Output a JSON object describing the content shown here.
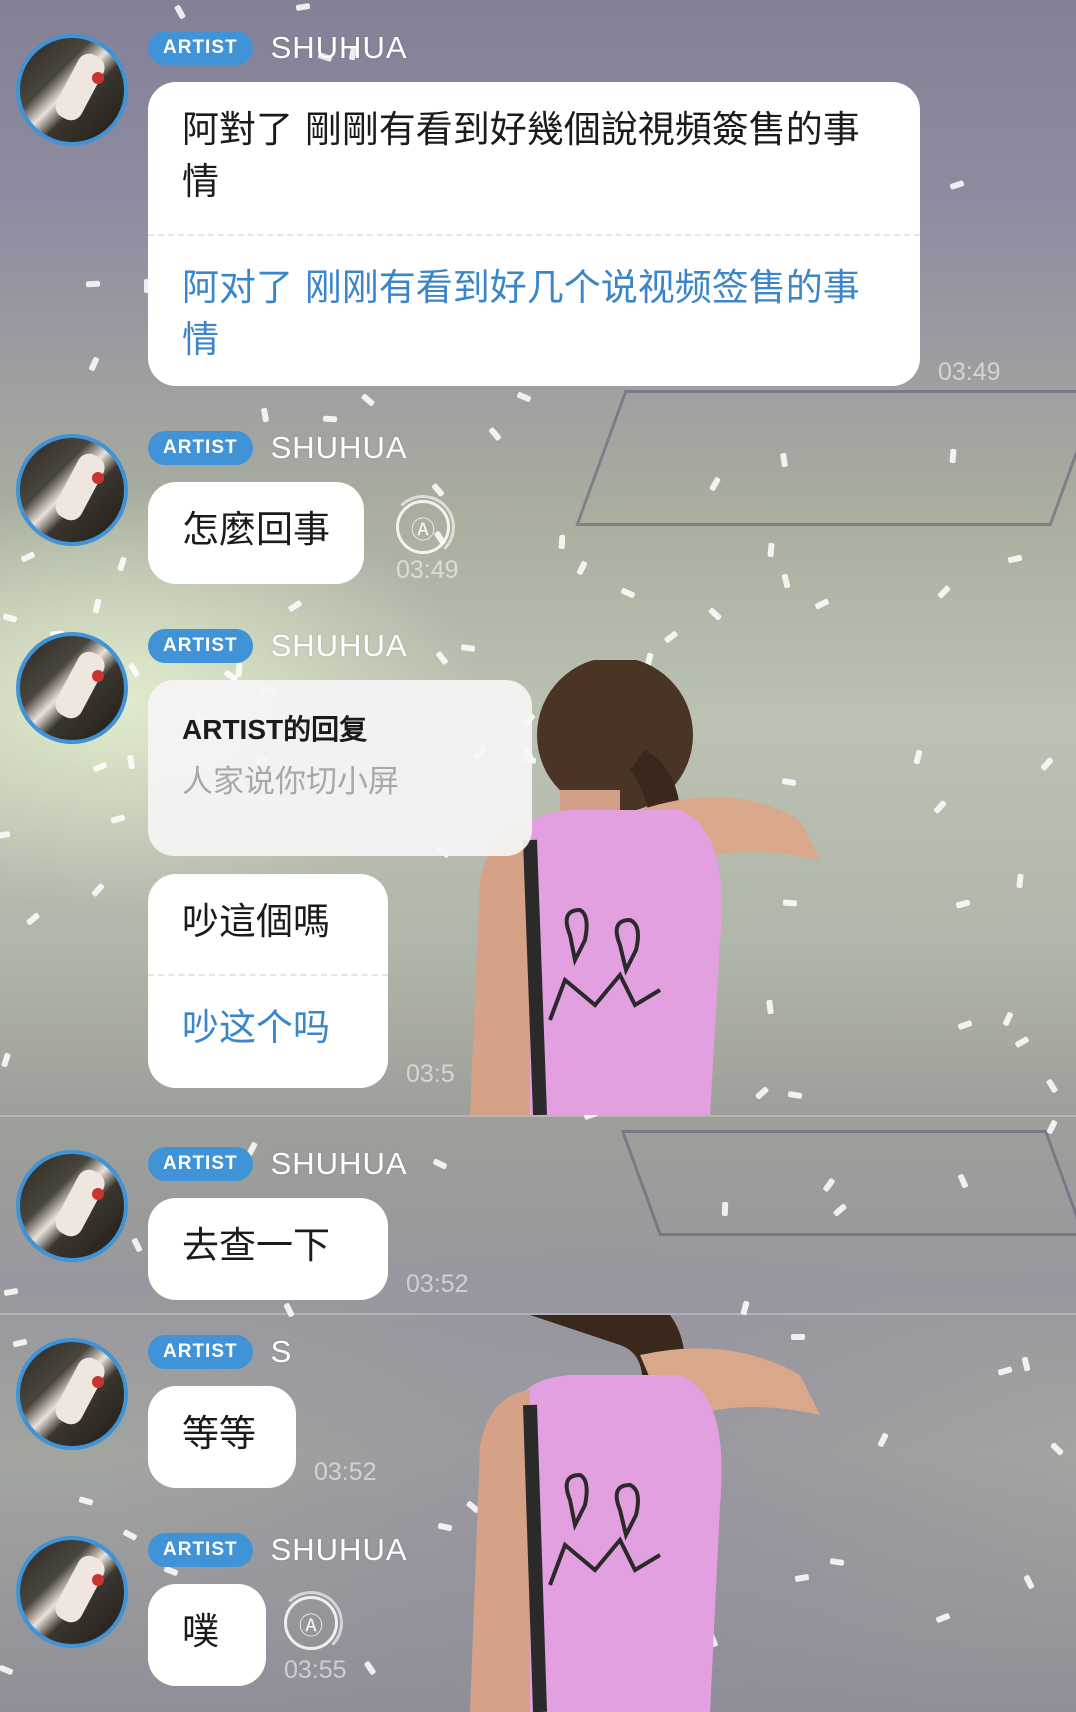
{
  "messages": [
    {
      "badge": "ARTIST",
      "sender": "SHUHUA",
      "text": "阿對了 剛剛有看到好幾個說視頻簽售的事情",
      "translation": "阿对了 刚刚有看到好几个说视频签售的事情",
      "time": "03:49"
    },
    {
      "badge": "ARTIST",
      "sender": "SHUHUA",
      "text": "怎麼回事",
      "time": "03:49",
      "translate_icon": "Ⓐ"
    },
    {
      "badge": "ARTIST",
      "sender": "SHUHUA",
      "reply_title": "ARTIST的回复",
      "reply_text": "人家说你切小屏",
      "text": "吵這個嗎",
      "translation": "吵这个吗",
      "time": "03:5"
    },
    {
      "badge": "ARTIST",
      "sender": "SHUHUA",
      "text": "去查一下",
      "time": "03:52"
    },
    {
      "badge": "ARTIST",
      "sender": "S",
      "text": "等等",
      "time": "03:52"
    },
    {
      "badge": "ARTIST",
      "sender": "SHUHUA",
      "text": "噗",
      "time": "03:55",
      "translate_icon": "Ⓐ"
    }
  ],
  "colors": {
    "accent": "#3f93d6",
    "translation": "#3b86c9",
    "bubble": "#ffffff"
  },
  "icons": {
    "translate": "translate-icon",
    "avatar": "avatar"
  }
}
